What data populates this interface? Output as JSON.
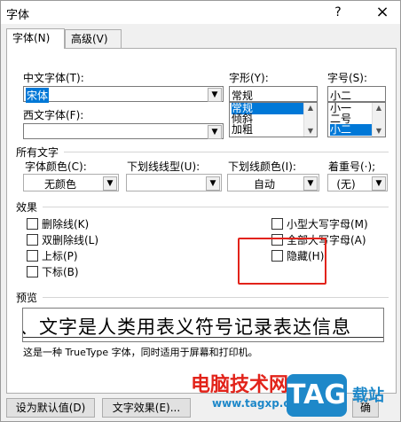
{
  "window": {
    "title": "字体",
    "help_label": "?",
    "close_label": "×"
  },
  "tabs": [
    {
      "label": "字体(N)",
      "active": true
    },
    {
      "label": "高级(V)",
      "active": false
    }
  ],
  "font": {
    "chinese_label": "中文字体(T):",
    "chinese_value": "宋体",
    "western_label": "西文字体(F):",
    "western_value": "",
    "style_label": "字形(Y):",
    "style_value": "常规",
    "style_options": [
      "常规",
      "倾斜",
      "加粗"
    ],
    "style_selected": "常规",
    "size_label": "字号(S):",
    "size_value": "小二",
    "size_options": [
      "小一",
      "二号",
      "小二"
    ],
    "size_selected": "小二"
  },
  "all_text": {
    "section_label": "所有文字",
    "font_color_label": "字体颜色(C):",
    "font_color_value": "无颜色",
    "underline_type_label": "下划线线型(U):",
    "underline_type_value": "",
    "underline_color_label": "下划线颜色(I):",
    "underline_color_value": "自动",
    "emphasis_label": "着重号(·);",
    "emphasis_value": "(无)"
  },
  "effects": {
    "section_label": "效果",
    "left": [
      "删除线(K)",
      "双删除线(L)",
      "上标(P)",
      "下标(B)"
    ],
    "right": [
      "小型大写字母(M)",
      "全部大写字母(A)",
      "隐藏(H)"
    ]
  },
  "preview": {
    "section_label": "预览",
    "sample_text": "、文字是人类用表义符号记录表达信息",
    "note": "这是一种 TrueType 字体，同时适用于屏幕和打印机。"
  },
  "buttons": {
    "set_default": "设为默认值(D)",
    "text_effects": "文字效果(E)...",
    "ok_partial": "确"
  },
  "watermark": {
    "line1": "电脑技术网",
    "url": "www.tagxp.com",
    "badge": "TAG",
    "suffix": "载站",
    "colors": {
      "red": "#e2231a",
      "blue": "#1e88c9"
    }
  }
}
